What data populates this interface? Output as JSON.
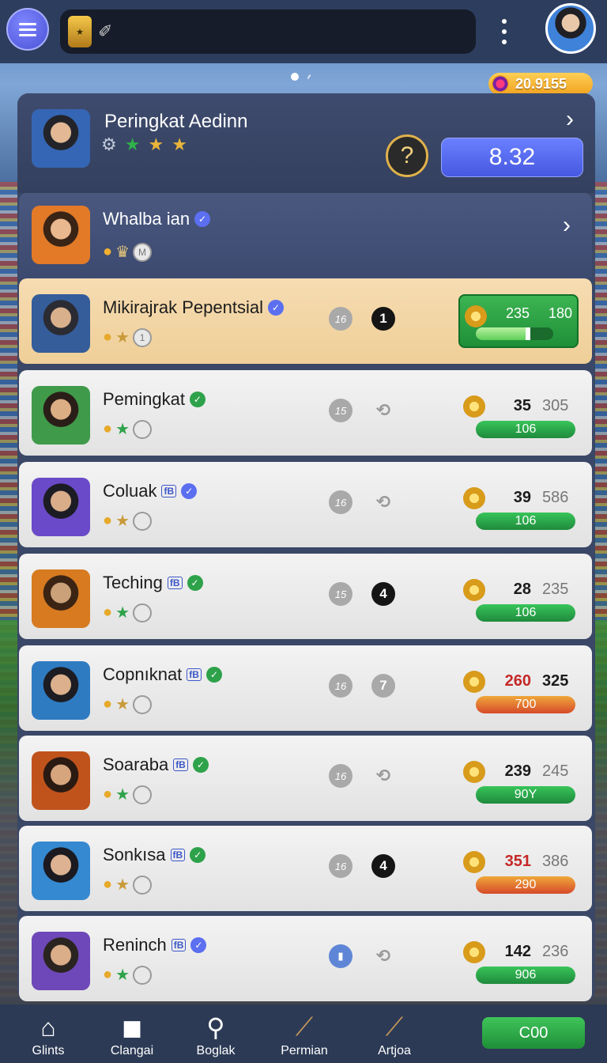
{
  "header": {
    "coins": "20.9155"
  },
  "hero": {
    "title": "Peringkat Aedinn",
    "score": "8.32",
    "timer_glyph": "?"
  },
  "featured": {
    "name": "Whalba ian"
  },
  "rows": [
    {
      "name": "Mikirajrak Pepentsial",
      "level": "16",
      "rank": "1",
      "stat_a": "235",
      "stat_b": "180",
      "progress": 0.7,
      "verified": "blue",
      "fb": false
    },
    {
      "name": "Pemingkat",
      "level": "15",
      "rank": "",
      "stat_a": "35",
      "stat_b": "305",
      "bar": "106",
      "bar_color": "green",
      "verified": "green",
      "fb": false
    },
    {
      "name": "Coluak",
      "level": "16",
      "rank": "",
      "stat_a": "39",
      "stat_b": "586",
      "bar": "106",
      "bar_color": "green",
      "verified": "blue",
      "fb": true
    },
    {
      "name": "Teching",
      "level": "15",
      "rank": "4",
      "stat_a": "28",
      "stat_b": "235",
      "bar": "106",
      "bar_color": "green",
      "verified": "green",
      "fb": true
    },
    {
      "name": "Copnıknat",
      "level": "16",
      "rank": "7",
      "stat_a": "260",
      "stat_b": "325",
      "bar": "700",
      "bar_color": "orange",
      "verified": "green",
      "fb": true
    },
    {
      "name": "Soaraba",
      "level": "16",
      "rank": "",
      "stat_a": "239",
      "stat_b": "245",
      "bar": "90Y",
      "bar_color": "green",
      "verified": "green",
      "fb": true
    },
    {
      "name": "Sonkısa",
      "level": "16",
      "rank": "4",
      "stat_a": "351",
      "stat_b": "386",
      "bar": "290",
      "bar_color": "orange",
      "verified": "green",
      "fb": true
    },
    {
      "name": "Reninch",
      "level": "",
      "rank": "",
      "stat_a": "142",
      "stat_b": "236",
      "bar": "906",
      "bar_color": "green",
      "verified": "blue",
      "fb": true
    }
  ],
  "nav": {
    "items": [
      "Glints",
      "Clangai",
      "Boglak",
      "Permian",
      "Artjoa"
    ],
    "action": "C00"
  },
  "colors": {
    "accent": "#5b6ff0",
    "green": "#2ea24a",
    "red": "#c42828",
    "gold": "#f0a320"
  }
}
